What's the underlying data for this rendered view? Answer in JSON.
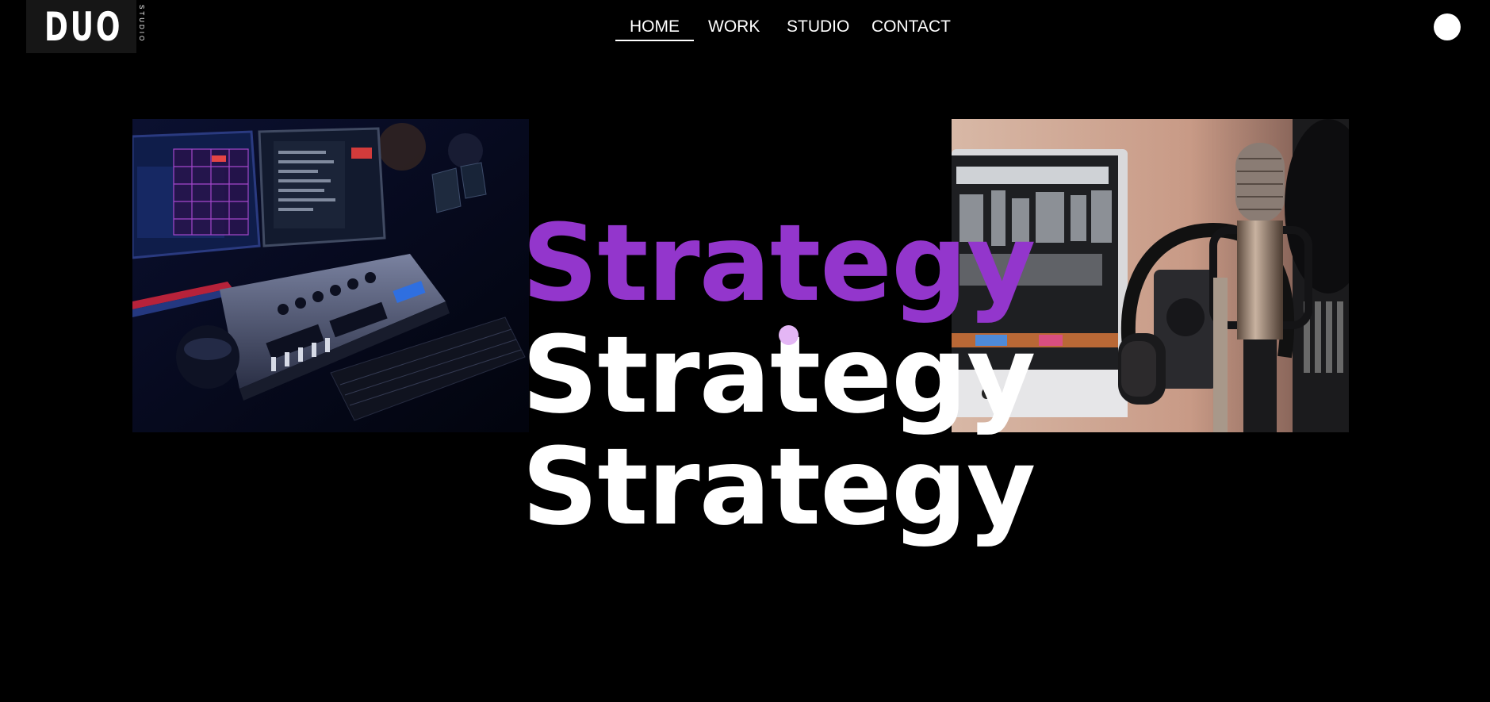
{
  "header": {
    "logo": {
      "main": "DUO",
      "sub": "STUDIO"
    },
    "nav": [
      {
        "label": "HOME",
        "active": true
      },
      {
        "label": "WORK",
        "active": false
      },
      {
        "label": "STUDIO",
        "active": false
      },
      {
        "label": "CONTACT",
        "active": false
      }
    ]
  },
  "hero": {
    "headlines": [
      "Strategy",
      "Strategy",
      "Strategy"
    ],
    "colors": {
      "accent": "#9336cc",
      "text": "#ffffff",
      "background": "#000000",
      "cursor": "#e4b6f5"
    },
    "images": [
      {
        "name": "lighting-console-photo"
      },
      {
        "name": "studio-microphone-photo"
      }
    ]
  }
}
